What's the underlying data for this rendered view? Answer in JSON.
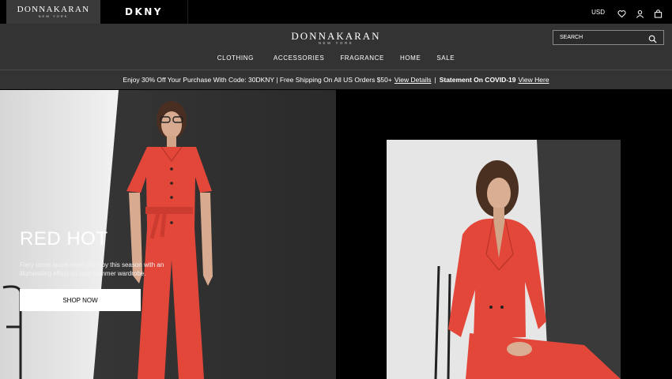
{
  "topbar": {
    "brand_primary": "DONNAKARAN",
    "brand_primary_sub": "NEW YORK",
    "brand_secondary": "DKNY",
    "currency": "USD",
    "icons": [
      "heart-icon",
      "user-icon",
      "bag-icon"
    ]
  },
  "header": {
    "logo": "DONNAKARAN",
    "logo_sub": "NEW YORK",
    "search_placeholder": "SEARCH",
    "nav": [
      "CLOTHING",
      "ACCESSORIES",
      "FRAGRANCE",
      "HOME",
      "SALE"
    ]
  },
  "promo": {
    "text1": "Enjoy 30% Off Your Purchase With Code: 30DKNY | Free Shipping On All US Orders $50+",
    "link1": "View Details",
    "separator": "|",
    "text2": "Statement On COVID-19",
    "link2": "View Here"
  },
  "hero": {
    "title": "RED HOT",
    "description": "Fiery tones spark more than joy this season with an illuminating effect on your summer wardrobe.",
    "cta": "SHOP NOW"
  },
  "colors": {
    "accent_red": "#e3473a",
    "header_bg": "#333333",
    "topbar_bg": "#000000"
  }
}
